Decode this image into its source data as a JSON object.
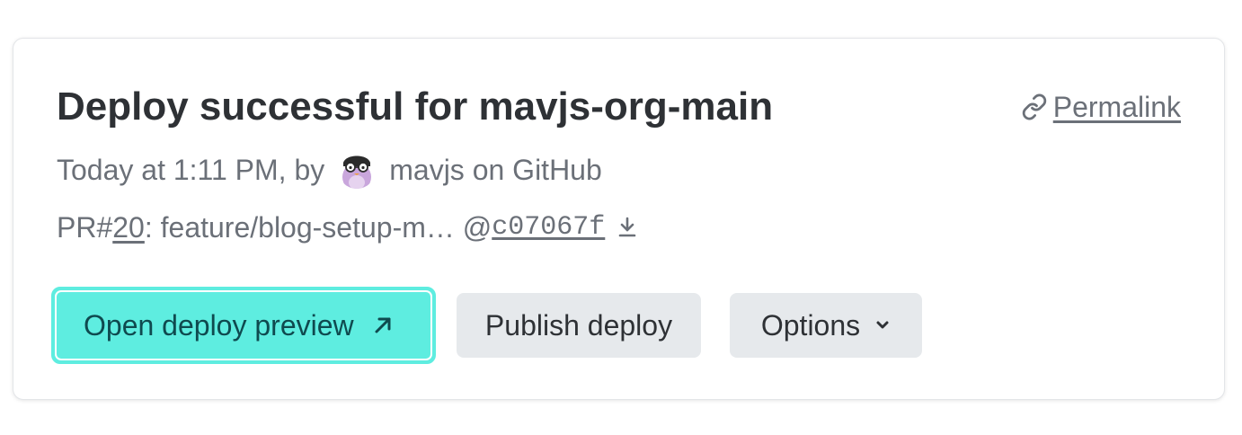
{
  "deploy": {
    "title": "Deploy successful for mavjs-org-main",
    "permalink_label": "Permalink",
    "meta_prefix": "Today at 1:11 PM, by",
    "author": "mavjs on GitHub",
    "pr_prefix": "PR#",
    "pr_number": "20",
    "branch_text": ": feature/blog-setup-m… @",
    "commit": "c07067f"
  },
  "actions": {
    "open_preview_label": "Open deploy preview",
    "publish_label": "Publish deploy",
    "options_label": "Options"
  },
  "icons": {
    "permalink": "link-icon",
    "download": "download-icon",
    "external": "arrow-up-right-icon",
    "options": "chevron-down-icon",
    "avatar": "github-avatar"
  },
  "colors": {
    "primary_button": "#5eede0",
    "primary_text": "#0f4a4f",
    "secondary_button": "#e6e9ec",
    "title_text": "#2e3135",
    "muted_text": "#6b7078"
  }
}
